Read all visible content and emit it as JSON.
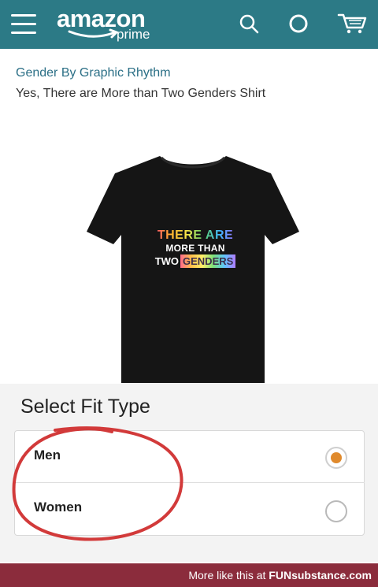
{
  "header": {
    "logo_word": "amazon",
    "logo_sub": "prime",
    "background": "#2c7a86",
    "icons": [
      "menu-icon",
      "search-icon",
      "circle-icon",
      "cart-icon"
    ]
  },
  "product": {
    "brand": "Gender By Graphic Rhythm",
    "title": "Yes, There are More than Two Genders Shirt",
    "shirt_text": {
      "line1": "THERE ARE",
      "line2": "MORE THAN",
      "line3a": "TWO",
      "line3b": "GENDERS"
    }
  },
  "fit_type": {
    "heading": "Select Fit Type",
    "options": [
      {
        "label": "Men",
        "selected": true
      },
      {
        "label": "Women",
        "selected": false
      }
    ],
    "accent": "#e08a2c"
  },
  "footer": {
    "text": "More like this at ",
    "brand": "FUNsubstance.com",
    "background": "#8b2c3c"
  }
}
